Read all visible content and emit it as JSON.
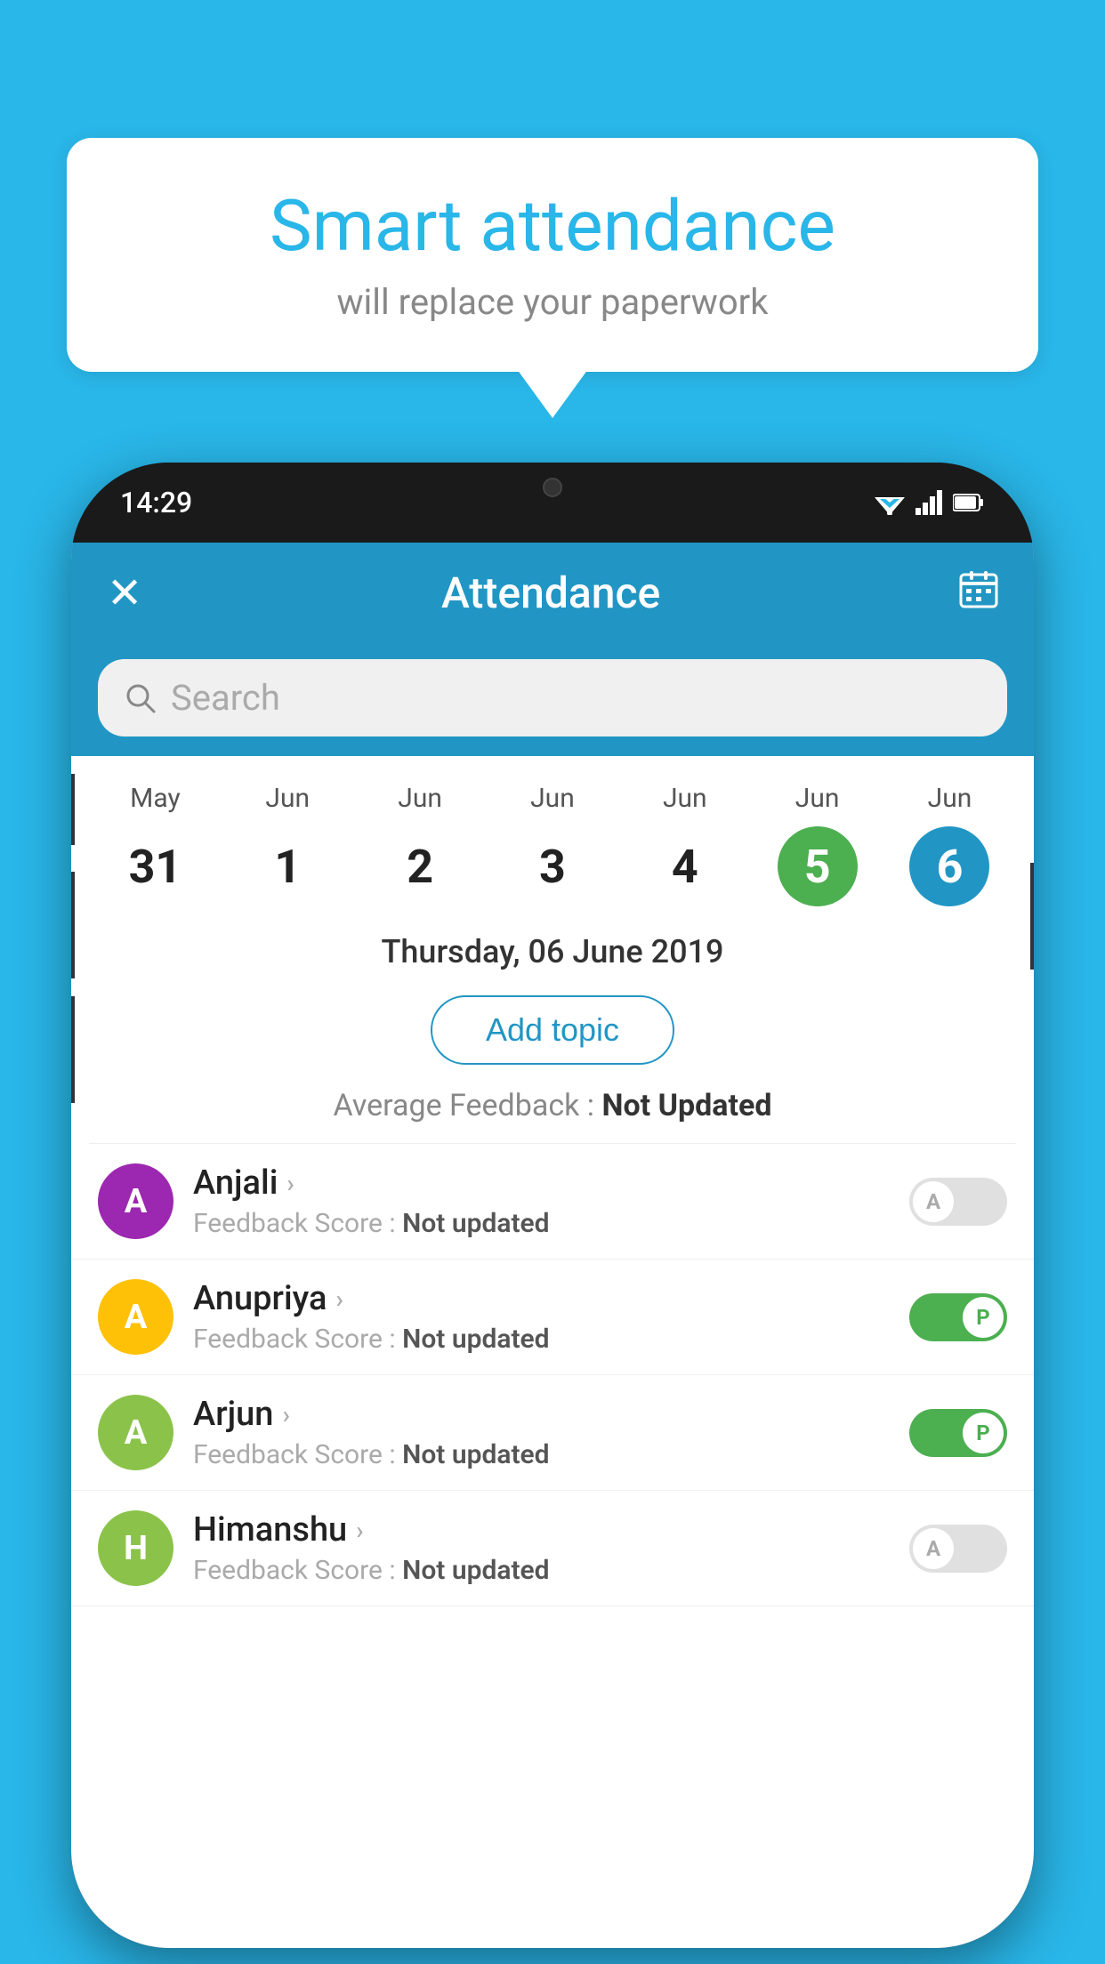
{
  "background_color": "#29b6e8",
  "speech_bubble": {
    "title": "Smart attendance",
    "subtitle": "will replace your paperwork"
  },
  "status_bar": {
    "time": "14:29",
    "wifi": "▼",
    "signal": "▲",
    "battery": "▮"
  },
  "header": {
    "title": "Attendance",
    "close_icon": "✕",
    "calendar_icon": "📅"
  },
  "search": {
    "placeholder": "Search"
  },
  "calendar": {
    "days": [
      {
        "month": "May",
        "date": "31",
        "style": "normal"
      },
      {
        "month": "Jun",
        "date": "1",
        "style": "normal"
      },
      {
        "month": "Jun",
        "date": "2",
        "style": "normal"
      },
      {
        "month": "Jun",
        "date": "3",
        "style": "normal"
      },
      {
        "month": "Jun",
        "date": "4",
        "style": "normal"
      },
      {
        "month": "Jun",
        "date": "5",
        "style": "today"
      },
      {
        "month": "Jun",
        "date": "6",
        "style": "selected"
      }
    ]
  },
  "selected_date": {
    "display": "Thursday, 06 June 2019"
  },
  "add_topic_label": "Add topic",
  "average_feedback": {
    "label": "Average Feedback :",
    "value": "Not Updated"
  },
  "students": [
    {
      "name": "Anjali",
      "avatar_letter": "A",
      "avatar_color": "#9c27b0",
      "feedback_label": "Feedback Score :",
      "feedback_value": "Not updated",
      "toggle": "off",
      "toggle_letter": "A"
    },
    {
      "name": "Anupriya",
      "avatar_letter": "A",
      "avatar_color": "#ffc107",
      "feedback_label": "Feedback Score :",
      "feedback_value": "Not updated",
      "toggle": "on",
      "toggle_letter": "P"
    },
    {
      "name": "Arjun",
      "avatar_letter": "A",
      "avatar_color": "#8bc34a",
      "feedback_label": "Feedback Score :",
      "feedback_value": "Not updated",
      "toggle": "on",
      "toggle_letter": "P"
    },
    {
      "name": "Himanshu",
      "avatar_letter": "H",
      "avatar_color": "#8bc34a",
      "feedback_label": "Feedback Score :",
      "feedback_value": "Not updated",
      "toggle": "off",
      "toggle_letter": "A"
    }
  ]
}
